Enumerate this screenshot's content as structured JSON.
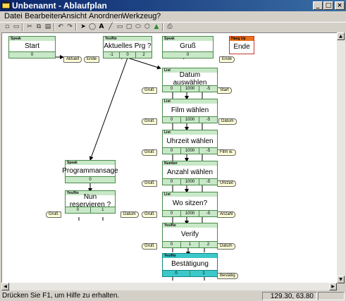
{
  "window": {
    "title": "Unbenannt - Ablaufplan"
  },
  "menu": [
    "Datei",
    "Bearbeiten",
    "Ansicht",
    "Anordnen",
    "Werkzeug",
    "?"
  ],
  "toolbar": {
    "icons": [
      "new-icon",
      "open-icon",
      "cut-icon",
      "copy-icon",
      "paste-icon",
      "undo-icon",
      "redo-icon",
      "pointer-icon",
      "lasso-icon",
      "text-icon",
      "line-icon",
      "rectangle-icon",
      "rounded-rect-icon",
      "ellipse-icon",
      "polygon-icon",
      "image-icon",
      "print-icon"
    ]
  },
  "nodes": [
    {
      "id": "start",
      "type": "Speak",
      "label": "Start",
      "values": [
        "0"
      ]
    },
    {
      "id": "aktuelles",
      "type": "Yes/No",
      "label": "Aktuelles Prg ?",
      "values": [
        "-1",
        "0",
        "2"
      ]
    },
    {
      "id": "gruss",
      "type": "Speak",
      "label": "Gruß",
      "values": [
        "0"
      ]
    },
    {
      "id": "ende",
      "type": "Hang Up",
      "label": "Ende",
      "values": []
    },
    {
      "id": "datum",
      "type": "List",
      "label": "Datum auswählen",
      "values": [
        "0",
        "1000",
        "-5"
      ]
    },
    {
      "id": "film",
      "type": "List",
      "label": "Film wählen",
      "values": [
        "0",
        "1000",
        "-5"
      ]
    },
    {
      "id": "uhrzeit",
      "type": "List",
      "label": "Uhrzeit wählen",
      "values": [
        "0",
        "1000",
        "-5"
      ]
    },
    {
      "id": "anzahl",
      "type": "Number",
      "label": "Anzahl wählen",
      "values": [
        "0",
        "1000",
        "-5"
      ]
    },
    {
      "id": "wo",
      "type": "List",
      "label": "Wo sitzen?",
      "values": [
        "0",
        "1000",
        "-5"
      ]
    },
    {
      "id": "verify",
      "type": "Yes/No",
      "label": "Verify",
      "values": [
        "0",
        "1",
        "2"
      ]
    },
    {
      "id": "bestaetigung",
      "type": "Yes/No",
      "label": "Bestätigung",
      "values": [
        "0",
        "1"
      ]
    },
    {
      "id": "programmansage",
      "type": "Speak",
      "label": "Programmansage",
      "values": [
        "0"
      ]
    },
    {
      "id": "reservieren",
      "type": "Yes/No",
      "label": "Nun reservieren ?",
      "values": [
        "0",
        "1"
      ]
    }
  ],
  "tags": [
    "Aktuell",
    "Ende",
    "Ende",
    "Gruß",
    "Start",
    "Gruß",
    "Datum",
    "Gruß",
    "Film w.",
    "Gruß",
    "Uhrzeit",
    "Gruß",
    "Anzahl",
    "Gruß",
    "Datum",
    "Gruß",
    "Datum",
    "Bestätig"
  ],
  "status": {
    "text": "Drücken Sie F1, um Hilfe zu erhalten.",
    "coords": "129.30, 63.80"
  },
  "colors": {
    "node_border": "#4a8a4a",
    "node_header": "#c8e8c8",
    "hangup_header": "#e8701a",
    "selected": "#3cc8c8",
    "tag_fill": "#ffffd8"
  }
}
